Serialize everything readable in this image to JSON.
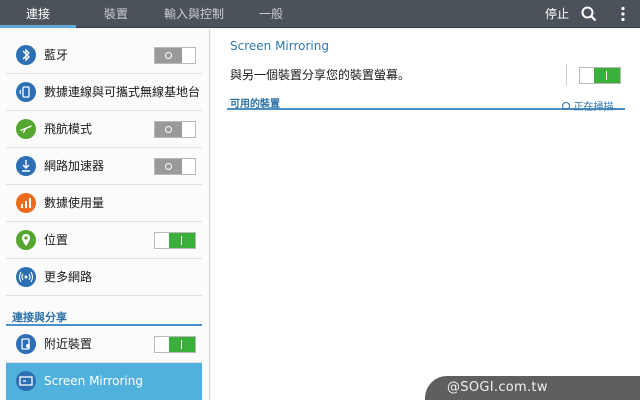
{
  "top_tabs": [
    {
      "label": "連接",
      "active": true
    },
    {
      "label": "裝置",
      "active": false
    },
    {
      "label": "輸入與控制",
      "active": false
    },
    {
      "label": "一般",
      "active": false
    }
  ],
  "toolbar": {
    "stop_label": "停止",
    "search_icon": "search-icon",
    "more_icon": "more-vert-icon"
  },
  "sidebar": {
    "items": [
      {
        "label": "藍牙",
        "icon": "bluetooth-icon",
        "icon_color": "#2d6fb5",
        "switch": "off"
      },
      {
        "label": "數據連線與可攜式無線基地台",
        "icon": "tethering-icon",
        "icon_color": "#2d6fb5",
        "switch": null
      },
      {
        "label": "飛航模式",
        "icon": "airplane-icon",
        "icon_color": "#55a630",
        "switch": "off"
      },
      {
        "label": "網路加速器",
        "icon": "download-booster-icon",
        "icon_color": "#2d6fb5",
        "switch": "off"
      },
      {
        "label": "數據使用量",
        "icon": "data-usage-icon",
        "icon_color": "#ee6a1f",
        "switch": null
      },
      {
        "label": "位置",
        "icon": "location-icon",
        "icon_color": "#55a630",
        "switch": "on"
      },
      {
        "label": "更多網路",
        "icon": "more-networks-icon",
        "icon_color": "#2d6fb5",
        "switch": null
      }
    ],
    "section_title": "連接與分享",
    "share_items": [
      {
        "label": "附近裝置",
        "icon": "nearby-devices-icon",
        "icon_color": "#2d6fb5",
        "switch": "on"
      },
      {
        "label": "Screen Mirroring",
        "icon": "screen-mirroring-icon",
        "icon_color": "#2d6fb5",
        "switch": null,
        "selected": true
      }
    ]
  },
  "main": {
    "title": "Screen Mirroring",
    "description": "與另一個裝置分享您的裝置螢幕。",
    "toggle_state": "on",
    "available_label": "可用的裝置",
    "scanning_label": "正在掃描..."
  },
  "watermark": "@SOGI.com.tw",
  "colors": {
    "accent": "#4a90c4",
    "selected_bg": "#4fb1dc",
    "switch_on": "#3ab03a",
    "topbar": "#4b5259"
  }
}
